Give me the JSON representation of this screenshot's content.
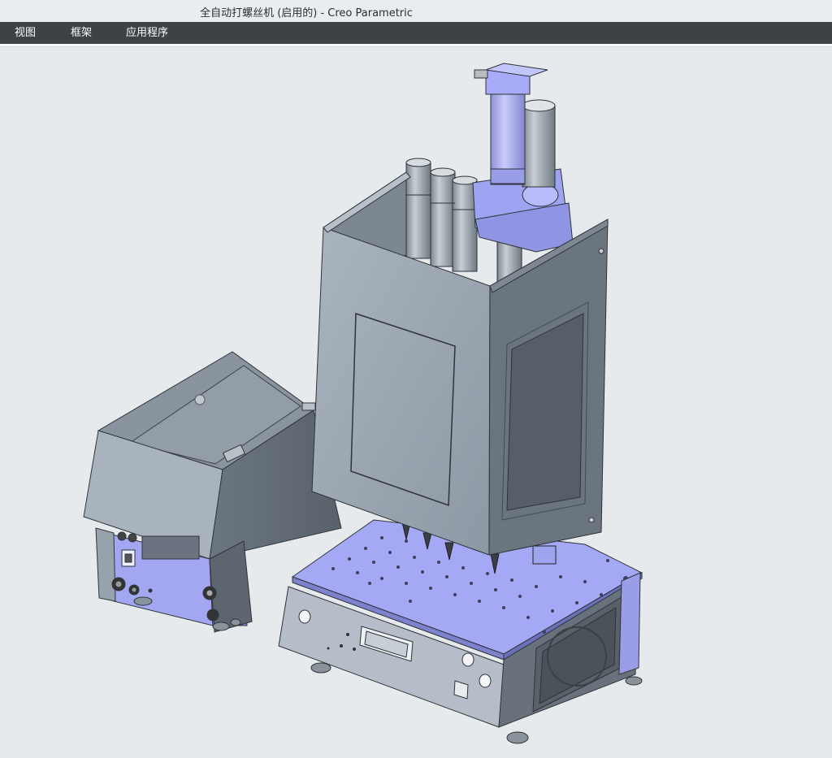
{
  "window": {
    "title": "全自动打螺丝机 (启用的) - Creo Parametric"
  },
  "menu": {
    "items": [
      {
        "label": "视图"
      },
      {
        "label": "框架"
      },
      {
        "label": "应用程序"
      }
    ]
  },
  "colors": {
    "titlebar_bg": "#eaedef",
    "menubar_bg": "#3c4245",
    "viewport_bg": "#e7eaed",
    "steel": "#9aa5b1",
    "steel_dark": "#5d666f",
    "accent_blue": "#9ea3f2"
  }
}
